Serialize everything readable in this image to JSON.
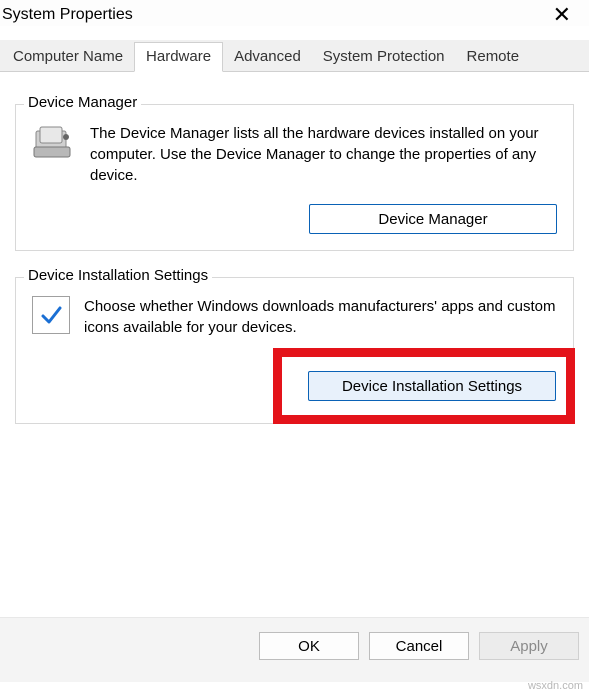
{
  "window": {
    "title": "System Properties"
  },
  "tabs": {
    "computer_name": "Computer Name",
    "hardware": "Hardware",
    "advanced": "Advanced",
    "system_protection": "System Protection",
    "remote": "Remote"
  },
  "device_manager": {
    "legend": "Device Manager",
    "text": "The Device Manager lists all the hardware devices installed on your computer. Use the Device Manager to change the properties of any device.",
    "button": "Device Manager"
  },
  "device_install": {
    "legend": "Device Installation Settings",
    "text": "Choose whether Windows downloads manufacturers' apps and custom icons available for your devices.",
    "button": "Device Installation Settings"
  },
  "footer": {
    "ok": "OK",
    "cancel": "Cancel",
    "apply": "Apply"
  },
  "watermark": "wsxdn.com"
}
